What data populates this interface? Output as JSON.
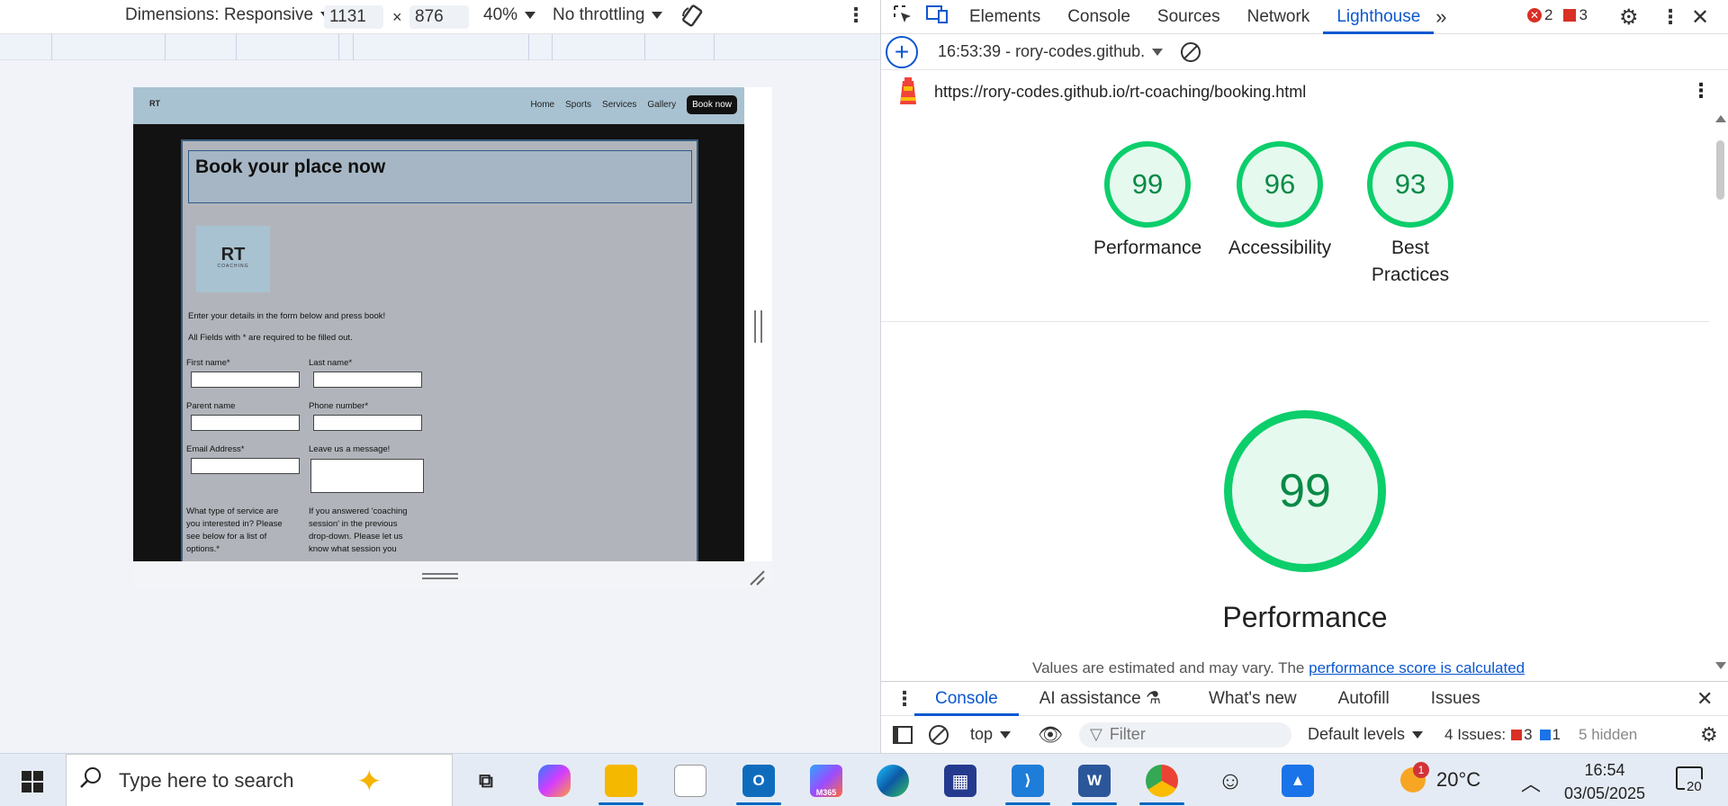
{
  "device_toolbar": {
    "dimensions_label": "Dimensions: Responsive",
    "width": "1131",
    "times": "×",
    "height": "876",
    "zoom": "40%",
    "throttling": "No throttling"
  },
  "site": {
    "nav": {
      "logo": "RT",
      "links": [
        "Home",
        "Sports",
        "Services",
        "Gallery"
      ],
      "book_button": "Book now"
    },
    "title": "Book your place now",
    "logo_text": "RT",
    "logo_sub": "COACHING",
    "intro": "Enter your details in the form below and press book!",
    "required_note": "All Fields with * are required to be filled out.",
    "labels": {
      "first_name": "First name*",
      "last_name": "Last name*",
      "parent_name": "Parent name",
      "phone": "Phone number*",
      "email": "Email Address*",
      "message": "Leave us a message!",
      "service_q": "What type of service are you interested in? Please see below for a list of options.*",
      "session_q": "If you answered 'coaching session' in the previous drop-down. Please let us know what session you"
    }
  },
  "devtools": {
    "tabs": [
      "Elements",
      "Console",
      "Sources",
      "Network",
      "Lighthouse"
    ],
    "active_tab": "Lighthouse",
    "errors": "2",
    "warnings": "3",
    "report_label": "16:53:39 - rory-codes.github.",
    "url": "https://rory-codes.github.io/rt-coaching/booking.html",
    "scores": [
      {
        "value": "99",
        "label": "Performance"
      },
      {
        "value": "96",
        "label": "Accessibility"
      },
      {
        "value": "93",
        "label": "Best Practices"
      }
    ],
    "big_score": {
      "value": "99",
      "label": "Performance"
    },
    "note_text": "Values are estimated and may vary. The ",
    "note_link": "performance score is calculated"
  },
  "drawer": {
    "tabs": [
      "Console",
      "AI assistance",
      "What's new",
      "Autofill",
      "Issues"
    ],
    "context": "top",
    "filter_placeholder": "Filter",
    "levels": "Default levels",
    "issues_label": "4 Issues:",
    "issues_errors": "3",
    "issues_info": "1",
    "hidden": "5 hidden"
  },
  "taskbar": {
    "search_placeholder": "Type here to search",
    "weather_badge": "1",
    "temperature": "20°C",
    "time": "16:54",
    "date": "03/05/2025",
    "notifications": "20",
    "m365": "M365",
    "colors": {
      "accent": "#0067c0",
      "lighthouse_green": "#0cce6b"
    }
  }
}
